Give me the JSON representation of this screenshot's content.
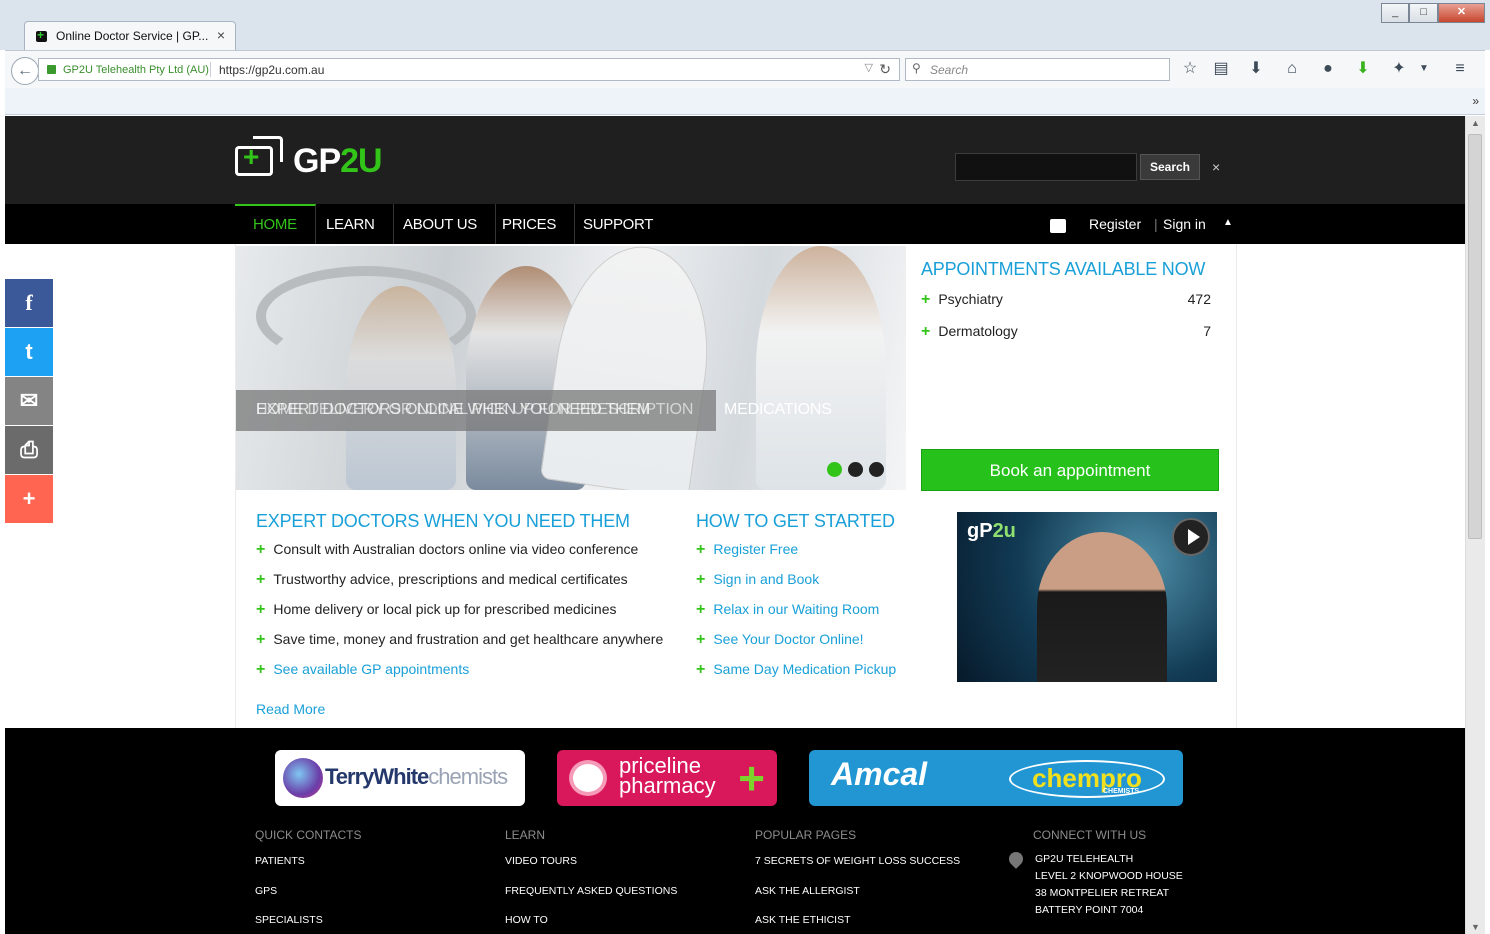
{
  "browser": {
    "tab_title": "Online Doctor Service | GP...",
    "tab_close": "×",
    "identity": "GP2U Telehealth Pty Ltd (AU)",
    "url": "https://gp2u.com.au",
    "search_placeholder": "Search",
    "overflow": "»"
  },
  "site": {
    "logo_text_white": "GP",
    "logo_text_green": "2U",
    "search_button": "Search",
    "search_close": "×",
    "menu": [
      {
        "label": "HOME"
      },
      {
        "label": "LEARN"
      },
      {
        "label": "ABOUT US"
      },
      {
        "label": "PRICES"
      },
      {
        "label": "SUPPORT"
      }
    ],
    "register": "Register",
    "pipe": "|",
    "sign_in": "Sign in",
    "caret": "▲"
  },
  "hero": {
    "caption_overlap": "EXPERT DOCTORS ONLINE WHEN YOU NEED THEM",
    "caption_overlap2": "HOME DELIVERY OR LOCAL PICK UP FOR PRESCRIPTION",
    "caption_tail": "MEDICATIONS",
    "active_slide": 1,
    "slides": 3
  },
  "appointments": {
    "title": "APPOINTMENTS AVAILABLE NOW",
    "rows": [
      {
        "label": "Psychiatry",
        "count": "472"
      },
      {
        "label": "Dermatology",
        "count": "7"
      }
    ],
    "book_button": "Book an appointment"
  },
  "expert": {
    "title": "EXPERT DOCTORS WHEN YOU NEED THEM",
    "items": [
      "Consult with Australian doctors online via video conference",
      "Trustworthy advice, prescriptions and medical certificates",
      "Home delivery or local pick up for prescribed medicines",
      "Save time, money and frustration and get healthcare anywhere"
    ],
    "link": "See available GP appointments",
    "read_more": "Read More"
  },
  "started": {
    "title": "HOW TO GET STARTED",
    "items": [
      "Register Free",
      "Sign in and Book",
      "Relax in our Waiting Room",
      "See Your Doctor Online!",
      "Same Day Medication Pickup"
    ]
  },
  "video": {
    "logo_a": "gP",
    "logo_b": "2u"
  },
  "partners": {
    "terry_a": "TerryWhite",
    "terry_b": "chemists",
    "priceline_a": "priceline",
    "priceline_b": "pharmacy",
    "priceline_cross": "+",
    "amcal": "Amcal",
    "chempro": "chempro",
    "chempro_sub": "CHEMISTS"
  },
  "footer": {
    "quick": {
      "title": "QUICK CONTACTS",
      "items": [
        "PATIENTS",
        "GPS",
        "SPECIALISTS"
      ]
    },
    "learn": {
      "title": "LEARN",
      "items": [
        "VIDEO TOURS",
        "FREQUENTLY ASKED QUESTIONS",
        "HOW TO"
      ]
    },
    "popular": {
      "title": "POPULAR PAGES",
      "items": [
        "7 SECRETS OF WEIGHT LOSS SUCCESS",
        "ASK THE ALLERGIST",
        "ASK THE ETHICIST"
      ]
    },
    "connect": {
      "title": "CONNECT WITH US",
      "address": [
        "GP2U TELEHEALTH",
        "LEVEL 2 KNOPWOOD HOUSE",
        "38 MONTPELIER RETREAT",
        "BATTERY POINT 7004"
      ]
    }
  },
  "share": {
    "facebook": "f",
    "twitter": "t",
    "email": "✉",
    "print": "⎙",
    "more": "+"
  },
  "colors": {
    "accent_green": "#33c41a",
    "accent_blue": "#1aa0d8",
    "header_bg": "#1f1f1f"
  }
}
